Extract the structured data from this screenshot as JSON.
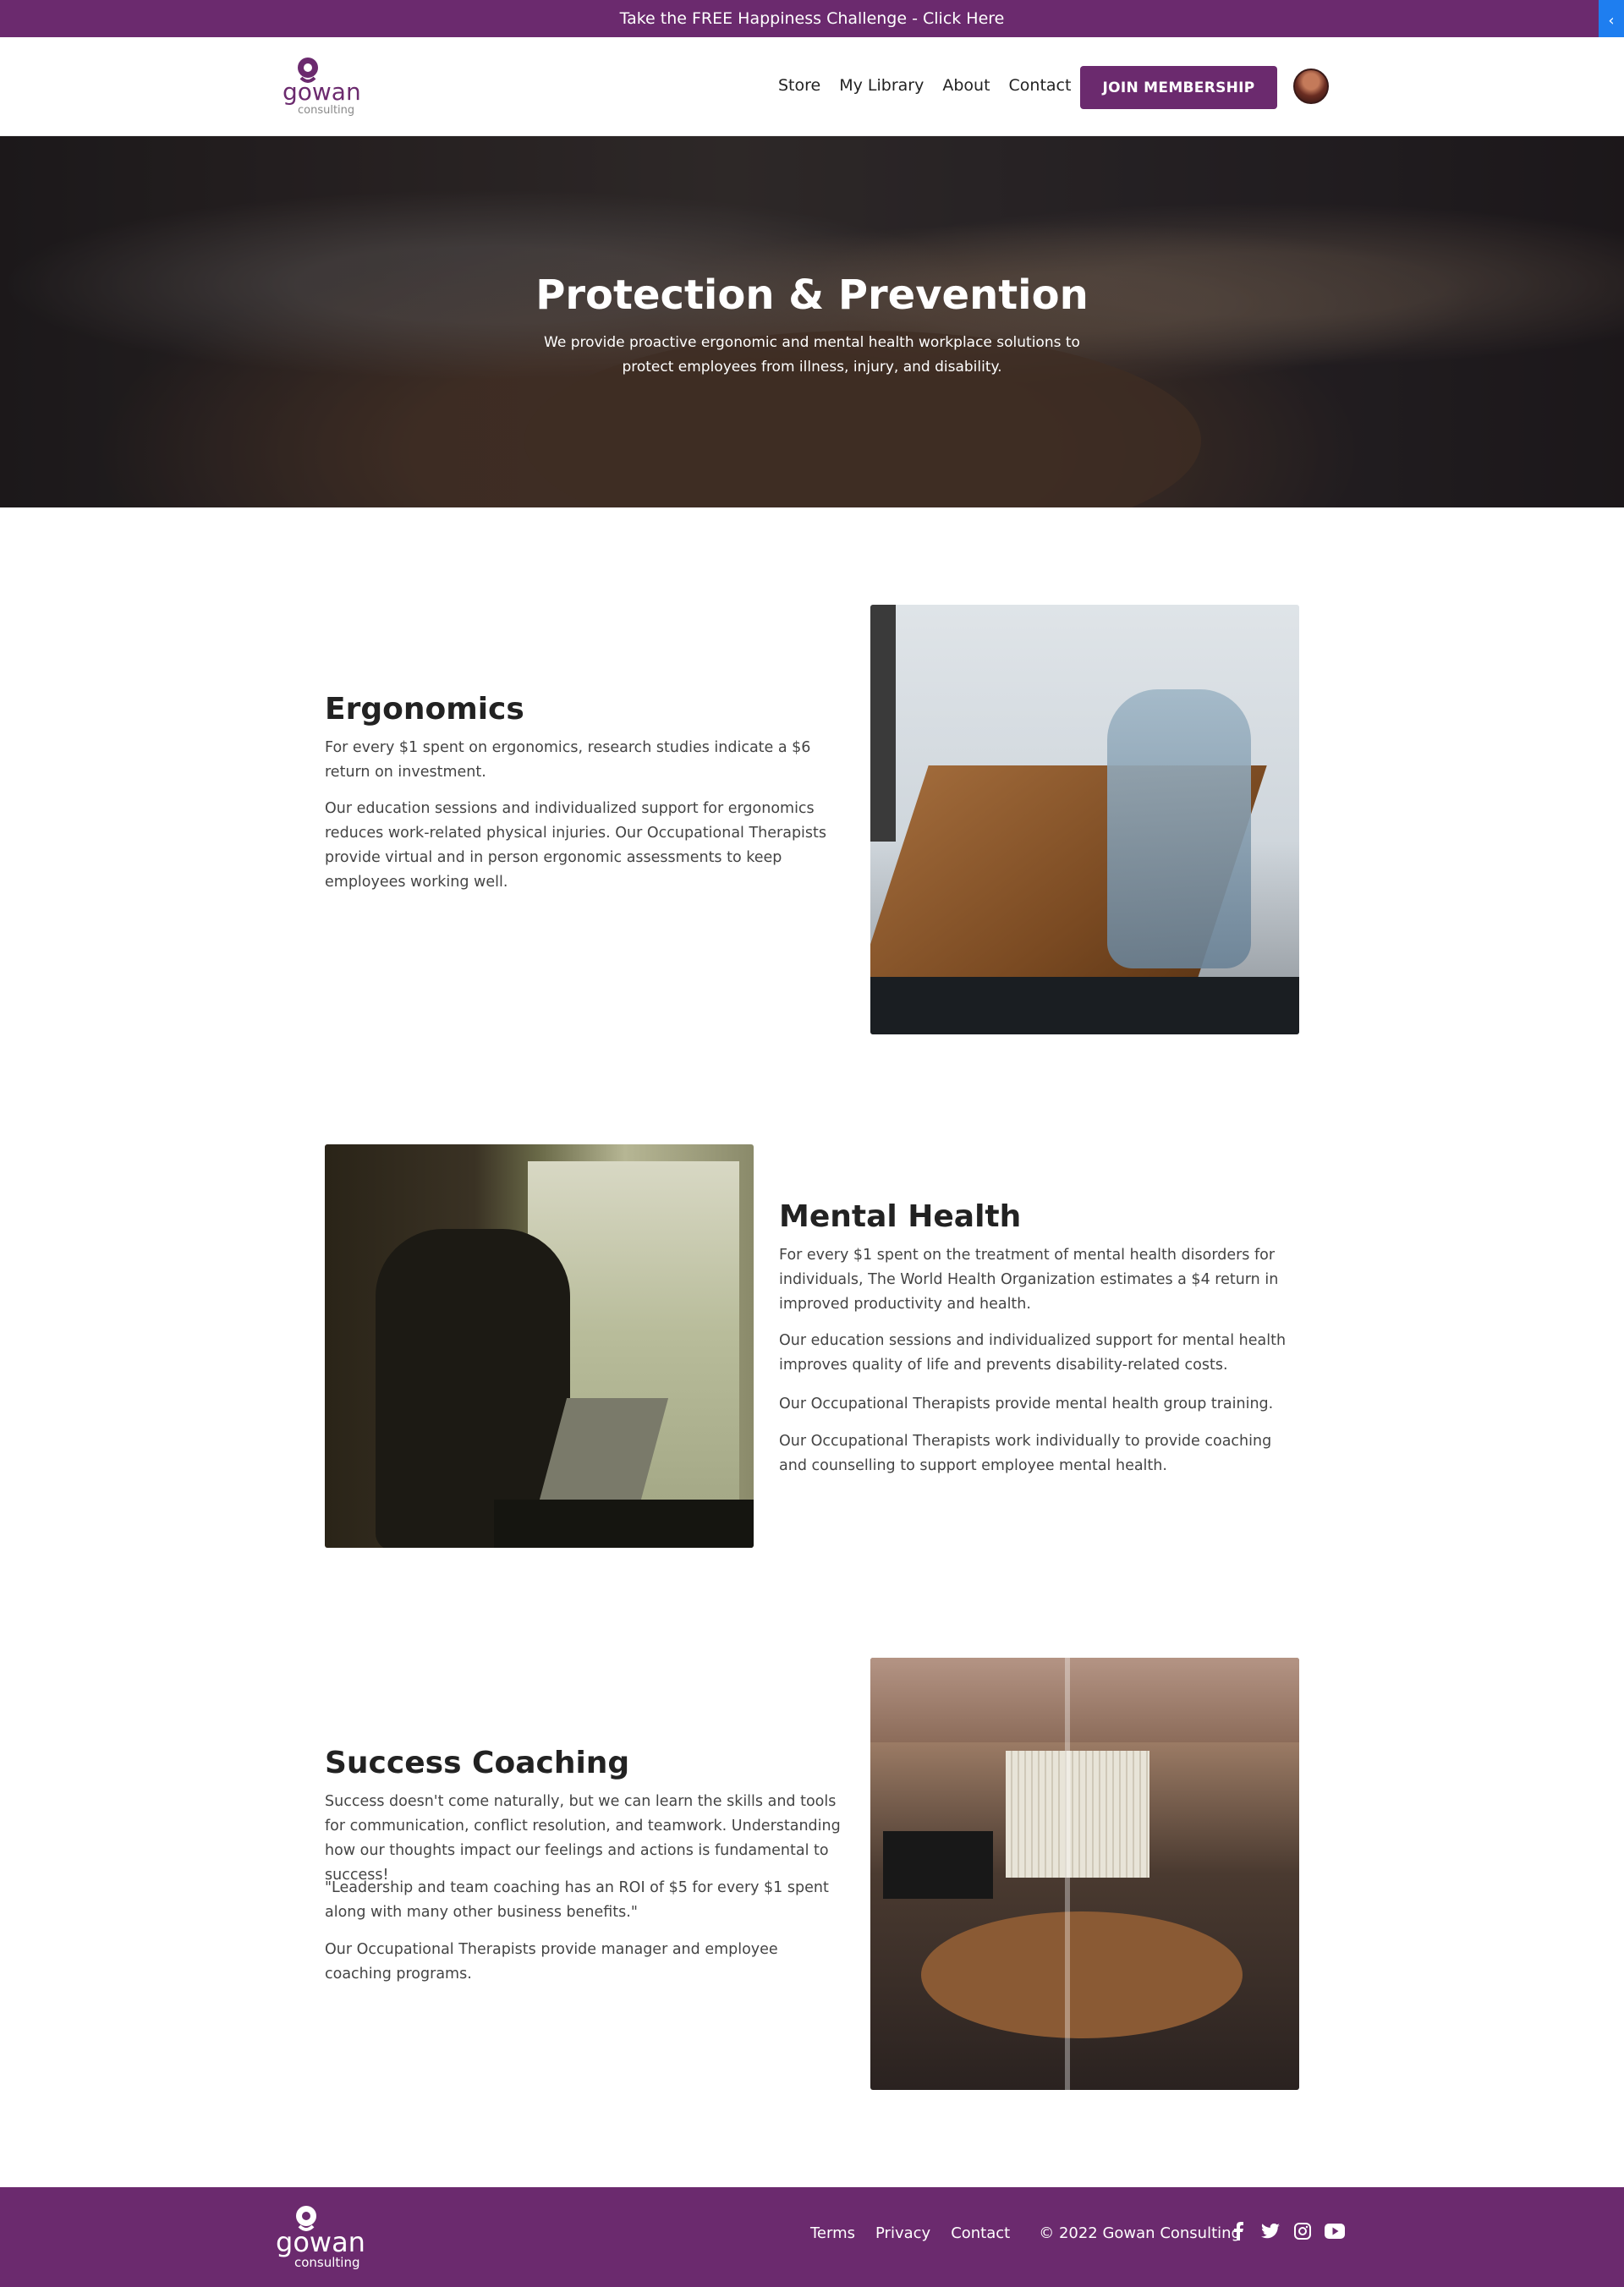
{
  "announcement": {
    "text": "Take the FREE Happiness Challenge - Click Here",
    "toggle_icon": "chevron-left-icon"
  },
  "header": {
    "logo_text": "gowan",
    "logo_sub": "consulting",
    "nav": [
      "Store",
      "My Library",
      "About",
      "Contact"
    ],
    "join_label": "JOIN MEMBERSHIP",
    "avatar": "user-avatar"
  },
  "hero": {
    "title": "Protection & Prevention",
    "subtitle": "We provide proactive ergonomic and mental health workplace solutions to protect employees from illness, injury, and disability."
  },
  "sections": [
    {
      "title": "Ergonomics",
      "paragraphs": [
        "For every $1 spent on ergonomics, research studies indicate a $6 return on investment.",
        "Our education sessions and individualized support for ergonomics reduces work-related physical injuries.  Our Occupational Therapists provide virtual and in person ergonomic assessments to keep employees working well."
      ]
    },
    {
      "title": "Mental Health",
      "paragraphs": [
        "For every $1 spent on the treatment of mental health disorders for individuals, The World Health Organization estimates a $4 return in improved productivity and health.",
        "Our education sessions and individualized support for mental health improves quality of life and prevents disability-related costs.",
        "Our Occupational Therapists provide mental health group training.",
        "Our Occupational Therapists work individually to provide coaching and counselling to support employee mental health."
      ]
    },
    {
      "title": "Success Coaching",
      "paragraphs": [
        "Success doesn't come naturally, but we can learn the skills and tools for communication, conflict resolution, and teamwork. Understanding how our thoughts impact our feelings and actions is fundamental to success!",
        "\"Leadership and team coaching has an ROI of $5 for every $1 spent along with many other business benefits.\"",
        "Our Occupational Therapists provide manager and employee coaching programs."
      ]
    }
  ],
  "footer": {
    "links": [
      "Terms",
      "Privacy",
      "Contact"
    ],
    "copyright": "© 2022 Gowan Consulting",
    "social": [
      "facebook-icon",
      "twitter-icon",
      "instagram-icon",
      "youtube-icon"
    ]
  },
  "colors": {
    "brand": "#6b2a6e",
    "accent_toggle": "#1e7ef0"
  }
}
